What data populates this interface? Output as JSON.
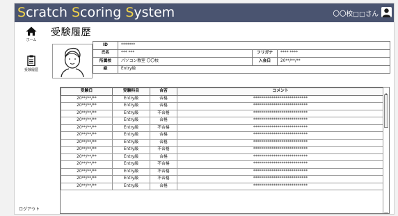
{
  "app": {
    "title_parts": [
      {
        "initial": "S",
        "rest": "cratch "
      },
      {
        "initial": "S",
        "rest": "coring "
      },
      {
        "initial": "S",
        "rest": "ystem"
      }
    ],
    "user_label": "〇〇校□□さん"
  },
  "sidebar": {
    "items": [
      {
        "label": "ホーム",
        "icon": "home-icon"
      },
      {
        "label": "受験履歴",
        "icon": "clipboard-icon"
      }
    ],
    "logout_label": "ログアウト"
  },
  "page": {
    "title": "受験履歴"
  },
  "profile": {
    "id_label": "ID",
    "id_value": "*******",
    "name_label": "氏名",
    "name_value": "*** ***",
    "furigana_label": "フリガナ",
    "furigana_value": "**** ****",
    "school_label": "所属校",
    "school_value": "パソコン教室 〇〇校",
    "joined_label": "入会日",
    "joined_value": "20**/**/**",
    "grade_label": "級",
    "grade_value": "Entry級"
  },
  "history": {
    "columns": [
      "受験日",
      "受験科目",
      "合否",
      "コメント"
    ],
    "rows": [
      {
        "date": "20**/**/**",
        "subject": "Entry級",
        "result": "合格",
        "comment": "***************************"
      },
      {
        "date": "20**/**/**",
        "subject": "Entry級",
        "result": "合格",
        "comment": "***************************"
      },
      {
        "date": "20**/**/**",
        "subject": "Entry級",
        "result": "不合格",
        "comment": "***************************"
      },
      {
        "date": "20**/**/**",
        "subject": "Entry級",
        "result": "合格",
        "comment": "***************************"
      },
      {
        "date": "20**/**/**",
        "subject": "Entry級",
        "result": "不合格",
        "comment": "***************************"
      },
      {
        "date": "20**/**/**",
        "subject": "Entry級",
        "result": "合格",
        "comment": "***************************"
      },
      {
        "date": "20**/**/**",
        "subject": "Entry級",
        "result": "合格",
        "comment": "***************************"
      },
      {
        "date": "20**/**/**",
        "subject": "Entry級",
        "result": "不合格",
        "comment": "***************************"
      },
      {
        "date": "20**/**/**",
        "subject": "Entry級",
        "result": "合格",
        "comment": "***************************"
      },
      {
        "date": "20**/**/**",
        "subject": "Entry級",
        "result": "不合格",
        "comment": "***************************"
      },
      {
        "date": "20**/**/**",
        "subject": "Entry級",
        "result": "不合格",
        "comment": "***************************"
      },
      {
        "date": "20**/**/**",
        "subject": "Entry級",
        "result": "不合格",
        "comment": "***************************"
      },
      {
        "date": "20**/**/**",
        "subject": "Entry級",
        "result": "合格",
        "comment": "***************************"
      }
    ]
  },
  "colors": {
    "header_bg": "#4a5470",
    "title_initial": "#f1d34a",
    "title_text": "#ffffff"
  }
}
